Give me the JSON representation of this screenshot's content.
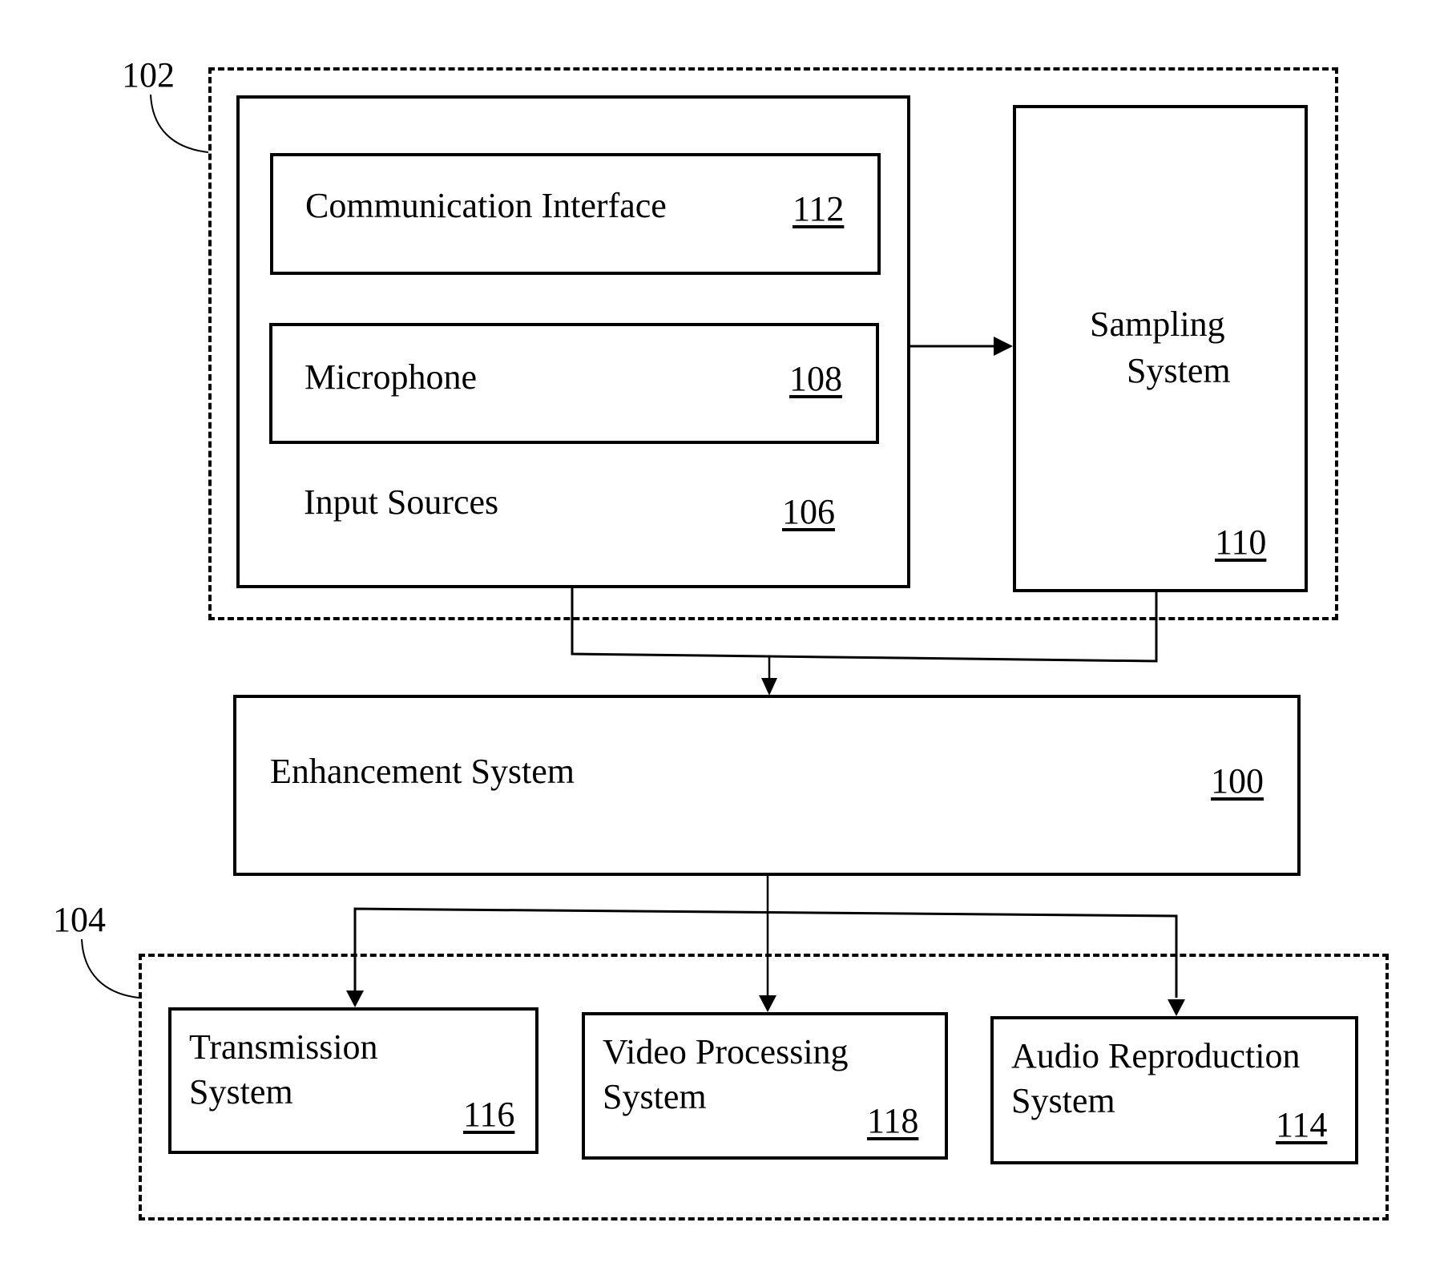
{
  "diagram": {
    "groups": {
      "input_group": {
        "ref": "102"
      },
      "output_group": {
        "ref": "104"
      }
    },
    "blocks": {
      "input_sources": {
        "label": "Input Sources",
        "ref": "106"
      },
      "communication_interface": {
        "label": "Communication Interface",
        "ref": "112"
      },
      "microphone": {
        "label": "Microphone",
        "ref": "108"
      },
      "sampling_system": {
        "label_line1": "Sampling",
        "label_line2": "System",
        "ref": "110"
      },
      "enhancement_system": {
        "label": "Enhancement System",
        "ref": "100"
      },
      "transmission_system": {
        "label_line1": "Transmission",
        "label_line2": "System",
        "ref": "116"
      },
      "video_processing_system": {
        "label_line1": "Video Processing",
        "label_line2": "System",
        "ref": "118"
      },
      "audio_reproduction_system": {
        "label_line1": "Audio Reproduction",
        "label_line2": "System",
        "ref": "114"
      }
    },
    "connections": [
      {
        "from": "input_sources",
        "to": "sampling_system"
      },
      {
        "from": "input_sources",
        "to": "enhancement_system"
      },
      {
        "from": "sampling_system",
        "to": "enhancement_system"
      },
      {
        "from": "enhancement_system",
        "to": "transmission_system"
      },
      {
        "from": "enhancement_system",
        "to": "video_processing_system"
      },
      {
        "from": "enhancement_system",
        "to": "audio_reproduction_system"
      }
    ]
  }
}
